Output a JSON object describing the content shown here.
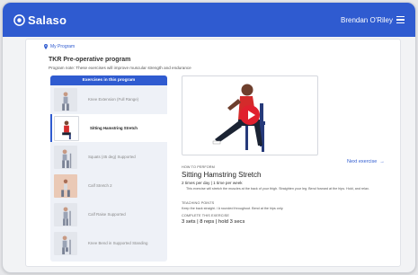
{
  "app": {
    "brand": "Salaso",
    "user_name": "Brendan O'Riley",
    "accent": "#2f5bd0"
  },
  "breadcrumb": "My Program",
  "program": {
    "title": "TKR Pre-operative program",
    "note": "Program note:  These exercises will improve muscular strength and endurance"
  },
  "exercise_list": {
    "heading": "Exercises in this program",
    "items": [
      {
        "label": "Knee Extension (Full Range)"
      },
      {
        "label": "Sitting Hamstring Stretch"
      },
      {
        "label": "Squats (45 deg) Supported"
      },
      {
        "label": "Calf Stretch 2"
      },
      {
        "label": "Calf Raise Supported"
      },
      {
        "label": "Knee Bend in Supported Standing"
      }
    ],
    "active_index": 1
  },
  "detail": {
    "next_label": "Next exercise",
    "how_to_label": "HOW TO PERFORM",
    "name": "Sitting Hamstring Stretch",
    "frequency": "2 times per day | 1 time per week",
    "description": "This exercise will stretch the muscles at the back of your thigh. Straighten your leg. Bend forward at the hips. Hold, and relax.",
    "teaching_points_label": "TEACHING POINTS",
    "teaching_points": "Keep the back straight. / A rounded throughout. Bend at the hips only.",
    "parameters_label": "COMPLETE THIS EXERCISE",
    "parameters": "3 sets | 8 reps | hold 3 secs"
  },
  "icons": [
    "salaso-logo-icon",
    "menu-icon",
    "pin-icon",
    "play-icon",
    "arrow-right-icon"
  ]
}
